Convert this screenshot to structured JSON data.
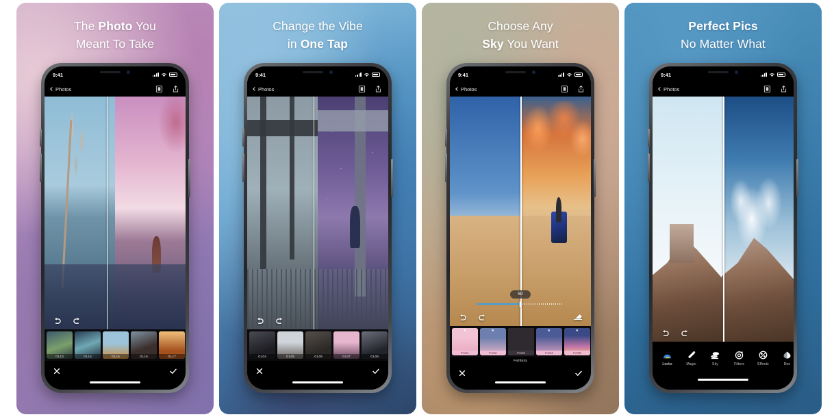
{
  "gallery": {
    "panels": [
      {
        "id": "panel-photo-you-meant-to-take",
        "title_line1_pre": "The ",
        "title_line1_bold": "Photo",
        "title_line1_post": " You",
        "title_line2": "Meant To Take",
        "phone": {
          "status": {
            "time": "9:41",
            "signal": "signal-icon",
            "wifi": "wifi-icon",
            "battery": "battery-icon"
          },
          "nav": {
            "back_label": "Photos",
            "compare_icon": "compare-icon",
            "share_icon": "share-icon"
          },
          "tools": {
            "undo": "undo-icon",
            "redo": "redo-icon"
          },
          "filmstrip": [
            {
              "label": "GL13",
              "selected": false
            },
            {
              "label": "GL14",
              "selected": false
            },
            {
              "label": "GL15",
              "selected": false
            },
            {
              "label": "GL16",
              "selected": false
            },
            {
              "label": "GL17",
              "selected": false
            }
          ],
          "footer": {
            "cancel": "close-icon",
            "confirm": "check-icon"
          }
        }
      },
      {
        "id": "panel-change-the-vibe",
        "title_line1_pre": "",
        "title_line1_bold": "",
        "title_line1_post": "Change the Vibe",
        "title_line2_pre": "in ",
        "title_line2_bold": "One Tap",
        "phone": {
          "status": {
            "time": "9:41",
            "signal": "signal-icon",
            "wifi": "wifi-icon",
            "battery": "battery-icon"
          },
          "nav": {
            "back_label": "Photos",
            "compare_icon": "compare-icon",
            "share_icon": "share-icon"
          },
          "tools": {
            "undo": "undo-icon",
            "redo": "redo-icon"
          },
          "filmstrip": [
            {
              "label": "GL04",
              "selected": false
            },
            {
              "label": "GL05",
              "selected": false
            },
            {
              "label": "GL06",
              "selected": false
            },
            {
              "label": "GL07",
              "selected": false
            },
            {
              "label": "GL08",
              "selected": false
            }
          ],
          "footer": {
            "cancel": "close-icon",
            "confirm": "check-icon"
          }
        }
      },
      {
        "id": "panel-choose-any-sky",
        "title_line1": "Choose Any",
        "title_line2_bold": "Sky",
        "title_line2_post": " You Want",
        "phone": {
          "status": {
            "time": "9:41",
            "signal": "signal-icon",
            "wifi": "wifi-icon",
            "battery": "battery-icon"
          },
          "nav": {
            "back_label": "Photos",
            "compare_icon": "compare-icon",
            "share_icon": "share-icon"
          },
          "tools": {
            "undo": "undo-icon",
            "redo": "redo-icon",
            "erase": "eraser-icon"
          },
          "slider": {
            "value": "50",
            "percent": 50
          },
          "filmstrip": [
            {
              "label": "FA01",
              "selected": false
            },
            {
              "label": "FA02",
              "selected": false
            },
            {
              "label": "FA03",
              "selected": true
            },
            {
              "label": "FA04",
              "selected": false
            },
            {
              "label": "FA05",
              "selected": false
            }
          ],
          "strip_caption": "Fantasy",
          "footer": {
            "cancel": "close-icon",
            "confirm": "check-icon"
          }
        }
      },
      {
        "id": "panel-perfect-pics",
        "title_line1_bold": "Perfect Pics",
        "title_line2": "No Matter What",
        "phone": {
          "status": {
            "time": "9:41",
            "signal": "signal-icon",
            "wifi": "wifi-icon",
            "battery": "battery-icon"
          },
          "nav": {
            "back_label": "Photos",
            "compare_icon": "compare-icon",
            "share_icon": "share-icon"
          },
          "tools": {
            "undo": "undo-icon",
            "redo": "redo-icon"
          },
          "tabs": [
            {
              "label": "Looks",
              "icon": "looks-icon",
              "active": true
            },
            {
              "label": "Magic",
              "icon": "magic-wand-icon",
              "active": false
            },
            {
              "label": "Sky",
              "icon": "sky-icon",
              "active": false
            },
            {
              "label": "Filters",
              "icon": "aperture-icon",
              "active": false
            },
            {
              "label": "Effects",
              "icon": "effects-icon",
              "active": false
            },
            {
              "label": "Den",
              "icon": "details-icon",
              "active": false
            }
          ]
        }
      }
    ]
  },
  "colors": {
    "accent": "#3aa0e8",
    "screen_black": "#000000",
    "text_white": "#ffffff",
    "panel1_bg": "#9d7fb8",
    "panel2_bg": "#3d6e9e",
    "panel3_bg": "#b08f70",
    "panel4_bg": "#2f6e9d"
  }
}
